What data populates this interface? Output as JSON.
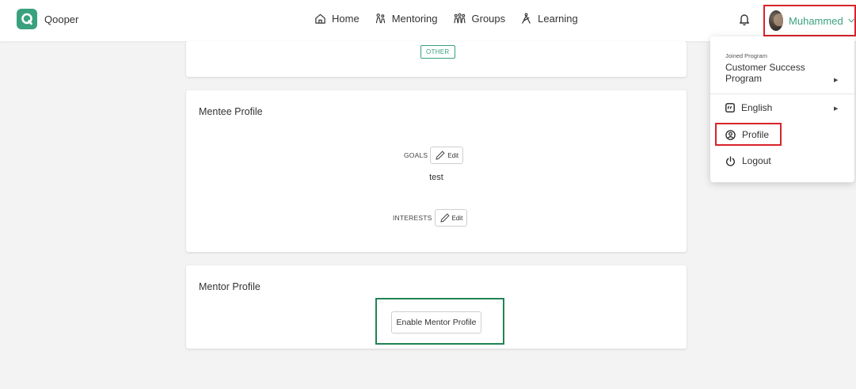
{
  "brand": {
    "name": "Qooper",
    "logo_letter": "Q",
    "color": "#3aa17e"
  },
  "nav": [
    {
      "label": "Home",
      "icon": "home-icon"
    },
    {
      "label": "Mentoring",
      "icon": "mentoring-icon"
    },
    {
      "label": "Groups",
      "icon": "groups-icon"
    },
    {
      "label": "Learning",
      "icon": "learning-icon"
    }
  ],
  "user": {
    "name": "Muhammed"
  },
  "cards": {
    "top": {
      "tag": "OTHER"
    },
    "mentee": {
      "title": "Mentee Profile",
      "goals_label": "GOALS",
      "goals_value": "test",
      "interests_label": "INTERESTS",
      "edit_label": "Edit"
    },
    "mentor": {
      "title": "Mentor Profile",
      "enable_label": "Enable Mentor Profile"
    }
  },
  "dropdown": {
    "joined_label": "Joined Program",
    "program_name": "Customer Success Program",
    "language": "English",
    "profile": "Profile",
    "logout": "Logout"
  },
  "colors": {
    "accent": "#3aa17e",
    "highlight_red": "#d8232a",
    "highlight_green": "#218355"
  }
}
